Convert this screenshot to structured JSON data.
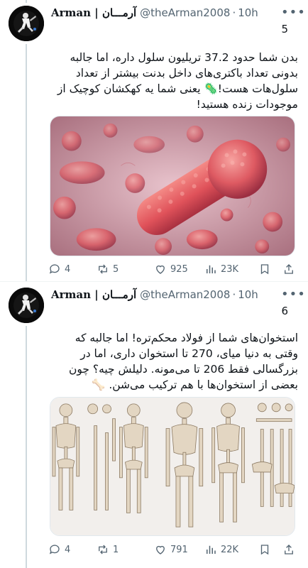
{
  "tweets": [
    {
      "display_name": "Arman | آرمـــان",
      "handle": "@theArman2008",
      "time": "10h",
      "more_icon": "more-icon",
      "thread_number": "5",
      "text": "بدن شما حدود 37.2 تریلیون سلول داره، اما جالبه بدونی تعداد باکتری‌های داخل بدنت بیشتر از تعداد سلول‌هات هست!🦠 یعنی شما یه کهکشان کوچیک از موجودات زنده هستید!",
      "media": "microscope-bacteria-illustration",
      "replies": "4",
      "retweets": "5",
      "likes": "925",
      "views": "23K"
    },
    {
      "display_name": "Arman | آرمـــان",
      "handle": "@theArman2008",
      "time": "10h",
      "more_icon": "more-icon",
      "thread_number": "6",
      "text": "استخوان‌های شما از فولاد محکم‌تره! اما جالبه که وقتی به دنیا میای، 270 تا استخوان داری، اما در بزرگسالی فقط 206 تا می‌مونه. دلیلش چیه؟ چون بعضی از استخوان‌ها با هم ترکیب می‌شن. 🦴",
      "media": "skeleton-bones-illustration",
      "replies": "4",
      "retweets": "1",
      "likes": "791",
      "views": "22K"
    }
  ],
  "colors": {
    "text": "#0f1419",
    "muted": "#536471",
    "thread_line": "#cfd9de",
    "bacteria": "#e0525a",
    "bacteria_bg": "#d7a7b4",
    "skeleton_bg": "#f2efec"
  },
  "icons": [
    "reply-icon",
    "retweet-icon",
    "like-icon",
    "views-icon",
    "bookmark-icon",
    "share-icon"
  ]
}
